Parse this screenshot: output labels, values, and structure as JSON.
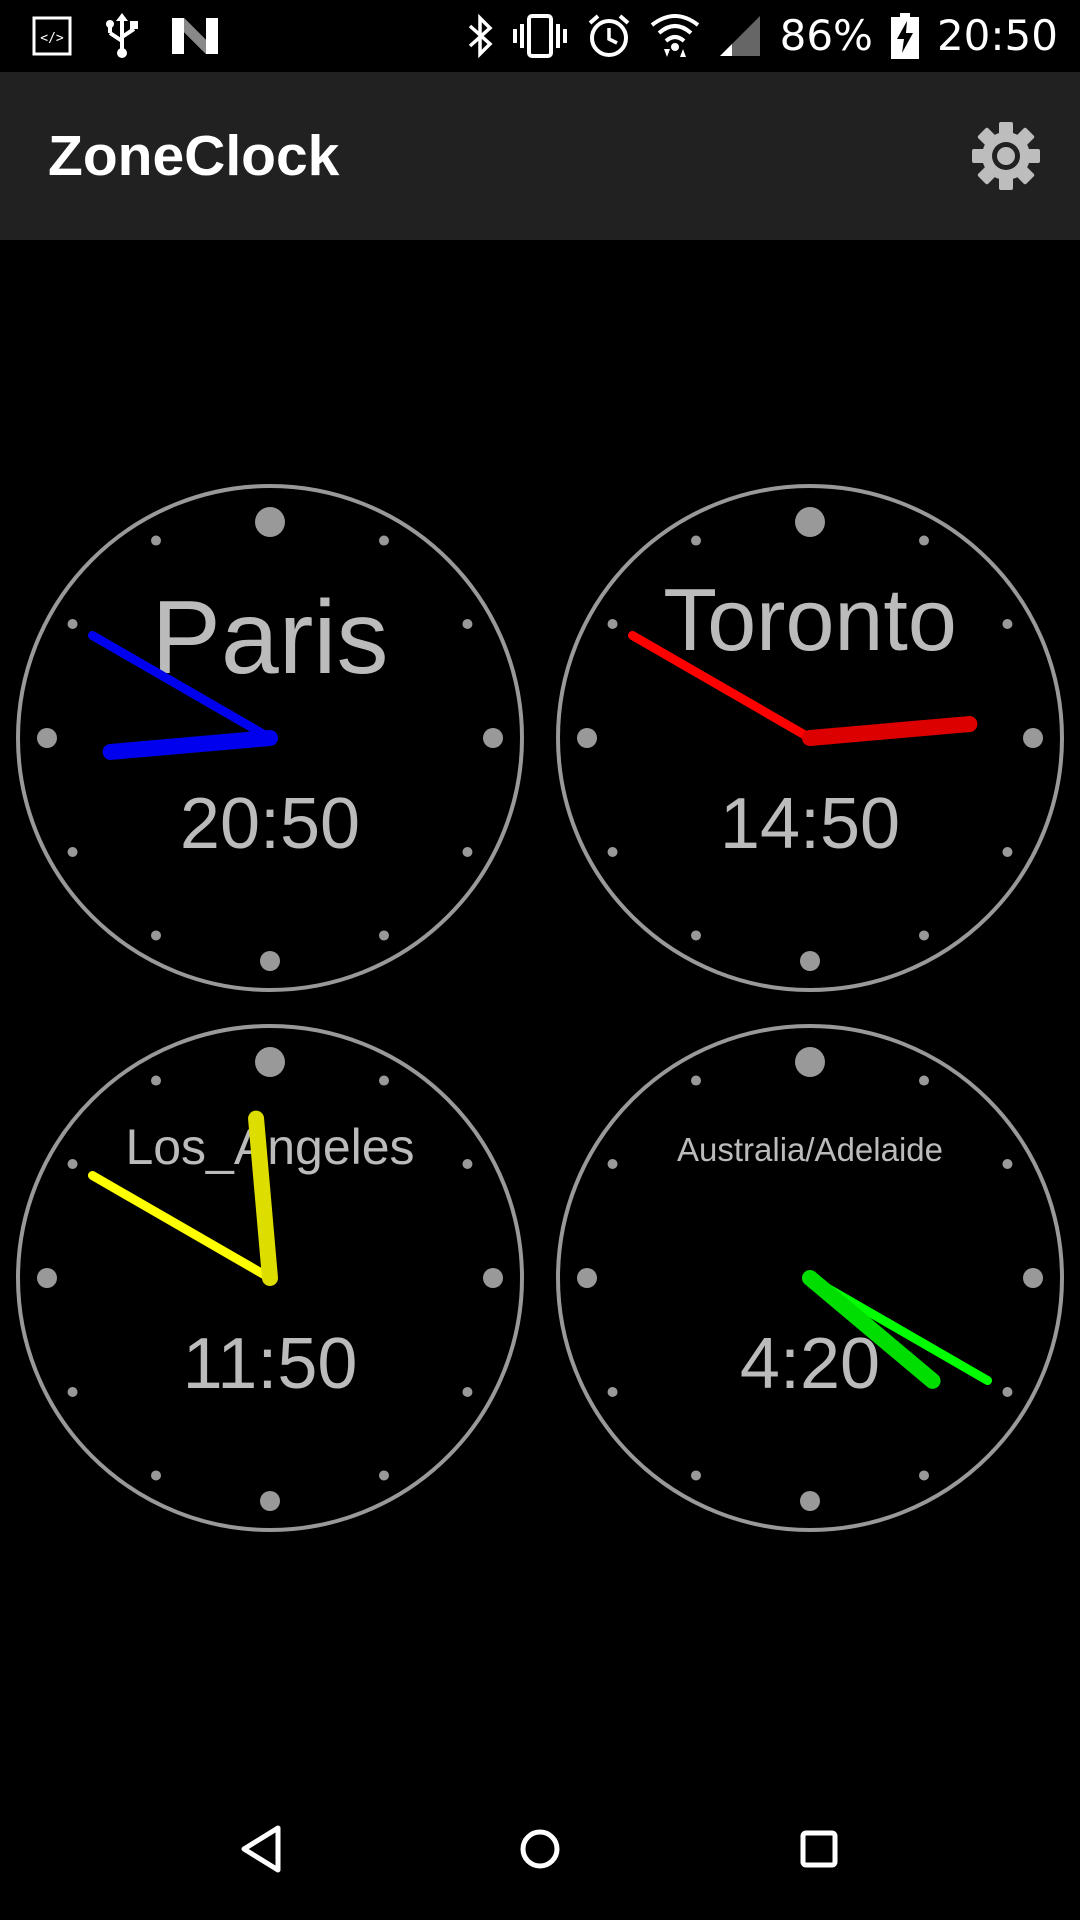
{
  "status_bar": {
    "left_icons": [
      "code-icon",
      "usb-icon",
      "n-icon"
    ],
    "right_icons": [
      "bluetooth-icon",
      "vibrate-icon",
      "alarm-icon",
      "wifi-icon",
      "signal-icon"
    ],
    "battery": "86%",
    "time": "20:50"
  },
  "app_bar": {
    "title": "ZoneClock",
    "settings_icon": "gear-icon"
  },
  "clocks": [
    {
      "city": "Paris",
      "time": "20:50",
      "hour": 20,
      "minute": 50,
      "hand_color_hour": "#0000ee",
      "hand_color_minute": "#0000ee"
    },
    {
      "city": "Toronto",
      "time": "14:50",
      "hour": 14,
      "minute": 50,
      "hand_color_hour": "#dd0000",
      "hand_color_minute": "#ff0000"
    },
    {
      "city": "Los_Angeles",
      "time": "11:50",
      "hour": 11,
      "minute": 50,
      "hand_color_hour": "#dddd00",
      "hand_color_minute": "#ffff00"
    },
    {
      "city": "Australia/Adelaide",
      "time": "4:20",
      "hour": 4,
      "minute": 20,
      "hand_color_hour": "#00dd00",
      "hand_color_minute": "#00ff00"
    }
  ],
  "colors": {
    "dial": "#999999",
    "text": "#bbbbbb",
    "app_bar": "#212121"
  },
  "nav_bar": {
    "back_icon": "back-icon",
    "home_icon": "home-icon",
    "recents_icon": "recents-icon"
  }
}
